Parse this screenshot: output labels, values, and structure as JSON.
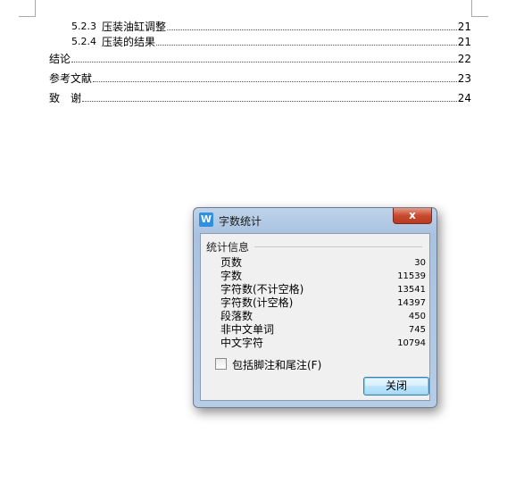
{
  "toc": [
    {
      "num": "5.2.3",
      "title": "压装油缸调整",
      "page": "21"
    },
    {
      "num": "5.2.4",
      "title": "压装的结果",
      "page": "21"
    },
    {
      "num": "",
      "title": "结论",
      "page": "22"
    },
    {
      "num": "",
      "title": "参考文献",
      "page": "23"
    },
    {
      "num": "",
      "title": "致　谢",
      "page": "24"
    }
  ],
  "dialog": {
    "title": "字数统计",
    "app_icon": "W",
    "close_label": "x",
    "group_label": "统计信息",
    "stats": [
      {
        "label": "页数",
        "value": "30"
      },
      {
        "label": "字数",
        "value": "11539"
      },
      {
        "label": "字符数(不计空格)",
        "value": "13541"
      },
      {
        "label": "字符数(计空格)",
        "value": "14397"
      },
      {
        "label": "段落数",
        "value": "450"
      },
      {
        "label": "非中文单词",
        "value": "745"
      },
      {
        "label": "中文字符",
        "value": "10794"
      }
    ],
    "checkbox_label": "包括脚注和尾注(F)",
    "checkbox_checked": false,
    "button_label": "关闭"
  }
}
